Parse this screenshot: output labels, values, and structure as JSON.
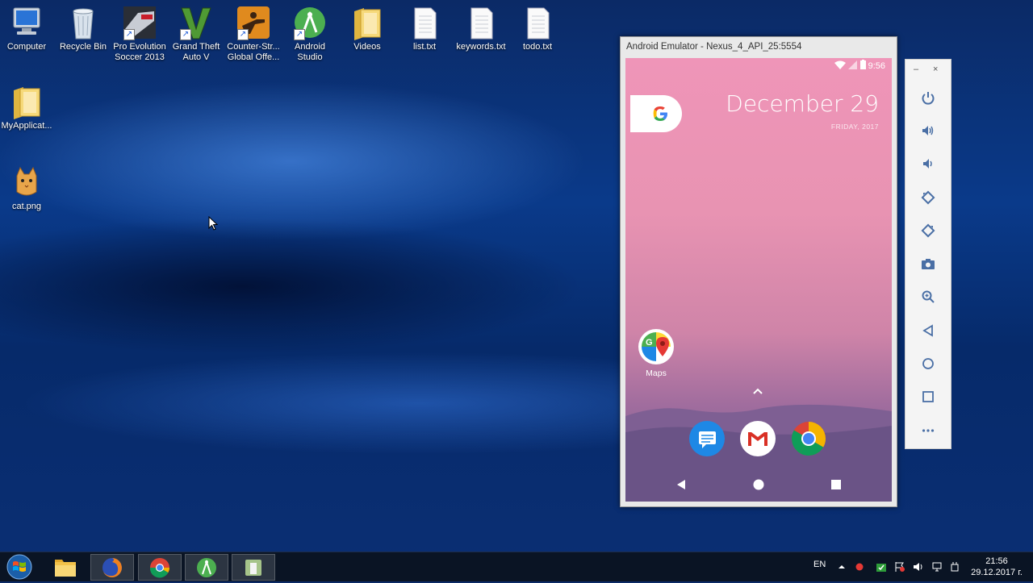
{
  "desktop": {
    "icons": [
      {
        "label": "Computer"
      },
      {
        "label": "Recycle Bin"
      },
      {
        "label": "Pro Evolution Soccer 2013"
      },
      {
        "label": "Grand Theft Auto V"
      },
      {
        "label": "Counter-Str... Global Offe..."
      },
      {
        "label": "Android Studio"
      },
      {
        "label": "Videos"
      },
      {
        "label": "list.txt"
      },
      {
        "label": "keywords.txt"
      },
      {
        "label": "todo.txt"
      },
      {
        "label": "MyApplicat..."
      },
      {
        "label": "cat.png"
      }
    ]
  },
  "emulator": {
    "title": "Android Emulator - Nexus_4_API_25:5554",
    "status_time": "9:56",
    "date": "December 29",
    "day": "FRIDAY, 2017",
    "apps": {
      "maps": "Maps"
    }
  },
  "taskbar": {
    "lang": "EN",
    "time": "21:56",
    "date": "29.12.2017 г."
  }
}
